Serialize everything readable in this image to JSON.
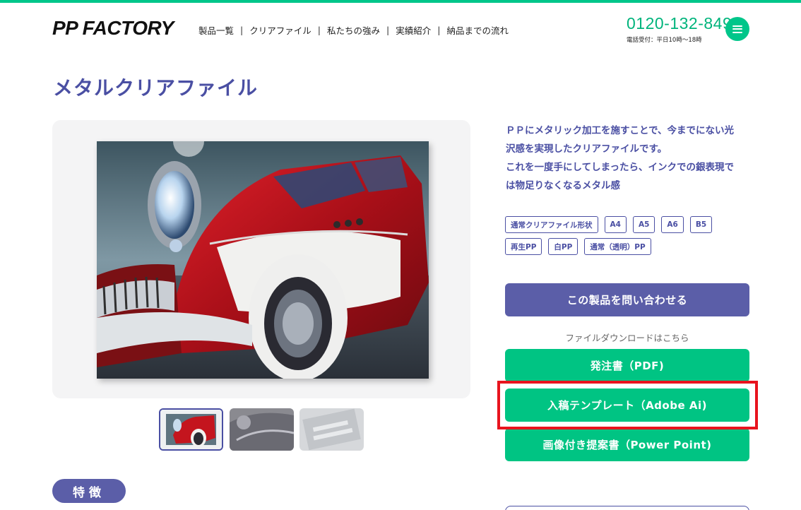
{
  "header": {
    "logo": "PP FACTORY",
    "nav": [
      {
        "label": "製品一覧"
      },
      {
        "label": "クリアファイル"
      },
      {
        "label": "私たちの強み"
      },
      {
        "label": "実績紹介"
      },
      {
        "label": "納品までの流れ"
      }
    ],
    "separator": "|",
    "phone": "0120-132-849",
    "phone_hours": "電話受付：平日10時〜18時",
    "menu_icon": "hamburger-icon"
  },
  "product": {
    "title": "メタルクリアファイル",
    "description_lines": [
      "ＰＰにメタリック加工を施すことで、今までにない光",
      "沢感を実現したクリアファイルです。",
      "これを一度手にしてしまったら、インクでの銀表現で",
      "は物足りなくなるメタル感"
    ],
    "tags": [
      "通常クリアファイル形状",
      "A4",
      "A5",
      "A6",
      "B5",
      "再生PP",
      "白PP",
      "通常（透明）PP"
    ]
  },
  "actions": {
    "inquiry_label": "この製品を問い合わせる",
    "download_caption": "ファイルダウンロードはこちら",
    "pdf_label": "発注書（PDF)",
    "ai_label": "入稿テンプレート（Adobe Ai)",
    "ppt_label": "画像付き提案書（Power Point)"
  },
  "features": {
    "label": "特徴"
  },
  "colors": {
    "brand_green": "#00c483",
    "brand_indigo": "#4a4fa3",
    "button_indigo": "#5b5ea8",
    "highlight_red": "#e8141e"
  }
}
